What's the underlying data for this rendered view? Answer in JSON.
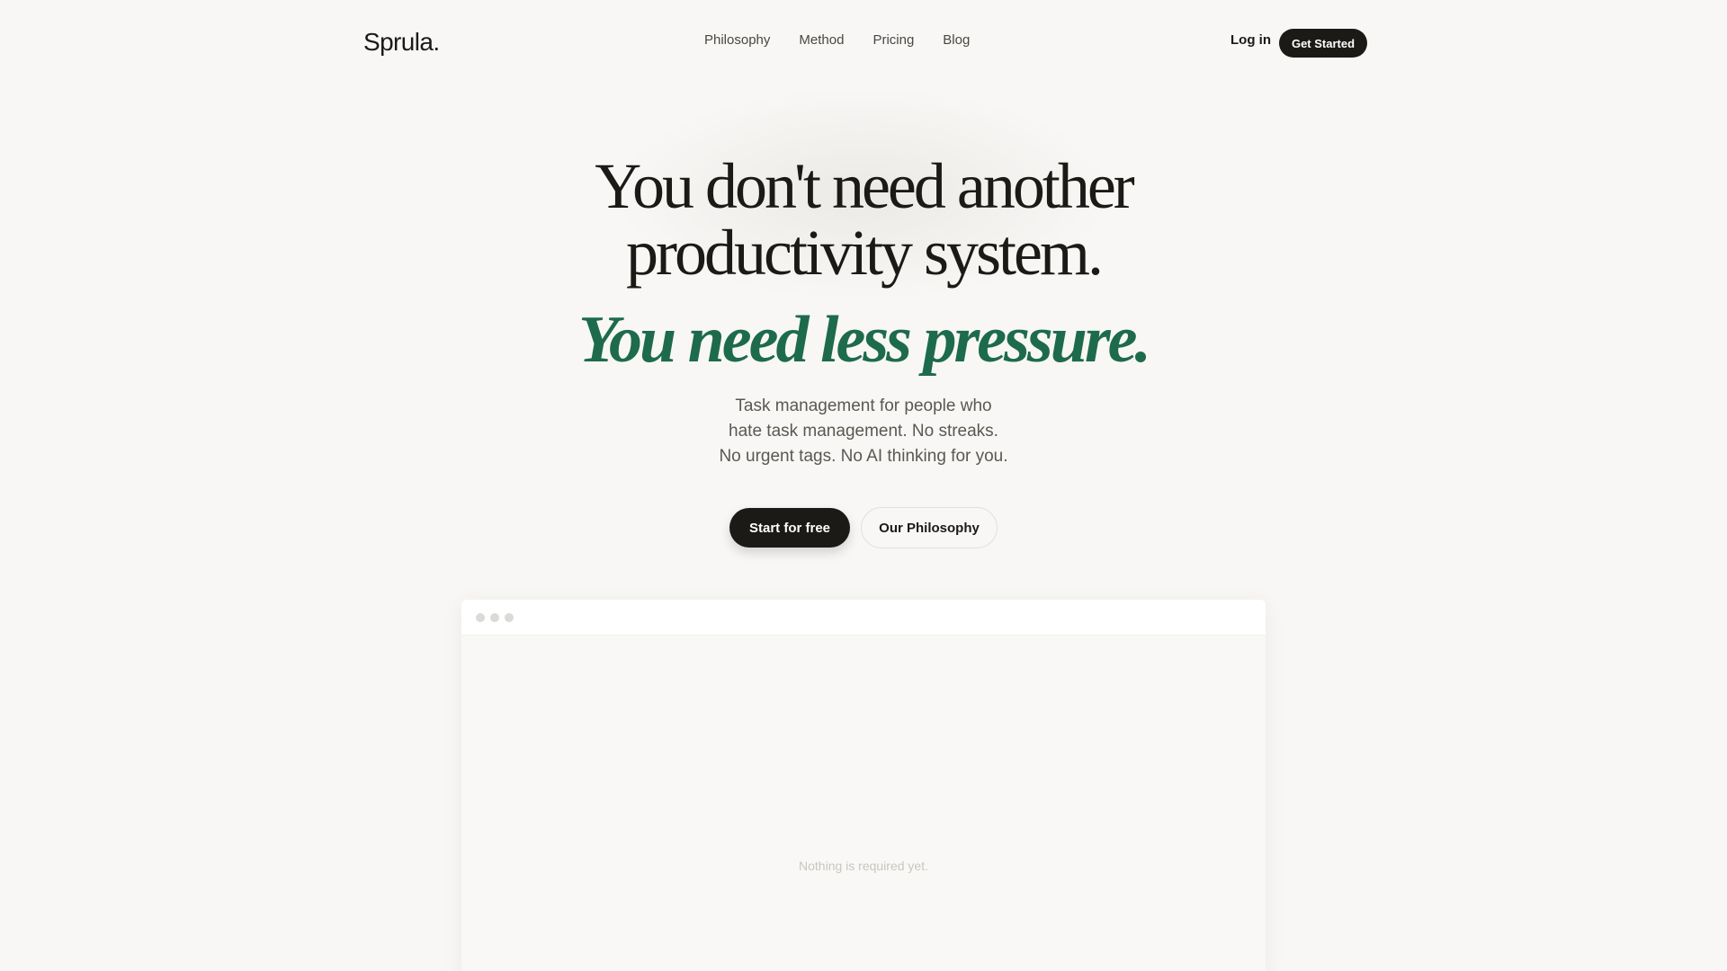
{
  "brand": {
    "logo": "Sprula."
  },
  "nav": {
    "items": [
      {
        "label": "Philosophy"
      },
      {
        "label": "Method"
      },
      {
        "label": "Pricing"
      },
      {
        "label": "Blog"
      }
    ],
    "login_label": "Log in",
    "get_started_label": "Get Started"
  },
  "hero": {
    "headline_line1": "You don't need another",
    "headline_line2": "productivity system.",
    "subheadline": "You need less pressure.",
    "description_line1": "Task management for people who",
    "description_line2": "hate task management. No streaks.",
    "description_line3": "No urgent tags. No AI thinking for you.",
    "primary_cta": "Start for free",
    "secondary_cta": "Our Philosophy"
  },
  "preview": {
    "empty_state": "Nothing is required yet."
  },
  "colors": {
    "background": "#f8f7f5",
    "text": "#1c1a17",
    "accent_green": "#1d6b4c",
    "button_dark": "#1c1a17"
  }
}
